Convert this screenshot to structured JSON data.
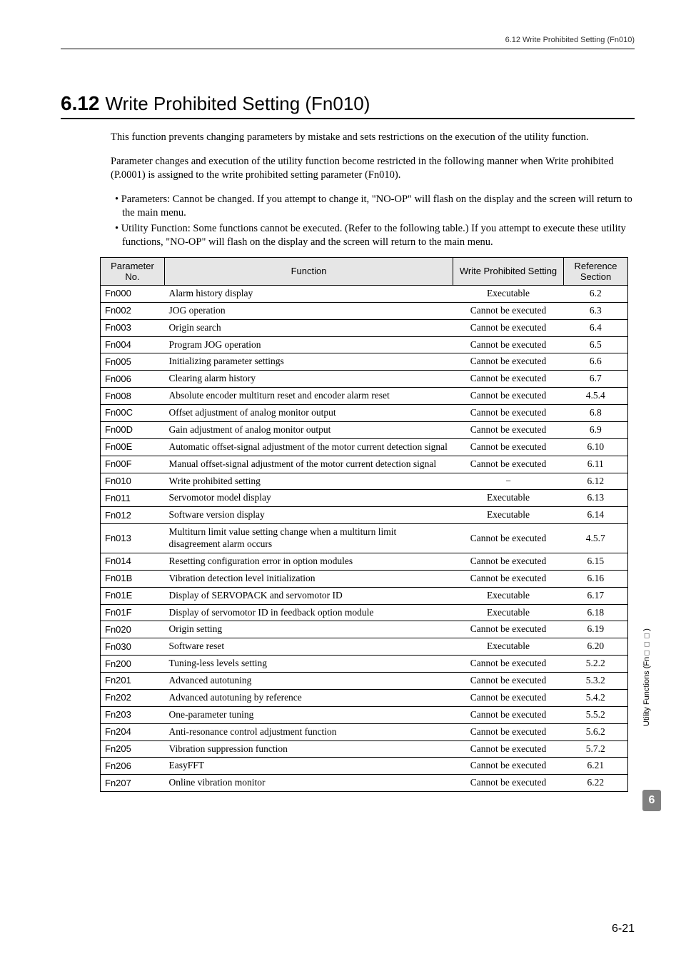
{
  "header": {
    "text": "6.12  Write Prohibited Setting (Fn010)"
  },
  "heading": {
    "num": "6.12",
    "title": "Write Prohibited Setting (Fn010)"
  },
  "intro": {
    "p1": "This function prevents changing parameters by mistake and sets restrictions on the execution of the utility function.",
    "p2": "Parameter changes and execution of the utility function become restricted in the following manner when Write prohibited (P.0001) is assigned to the write prohibited setting parameter (Fn010).",
    "b1": "Parameters: Cannot be changed. If you attempt to change it, \"NO-OP\" will flash on the display and the screen will return to the main menu.",
    "b2": "Utility Function: Some functions cannot be executed. (Refer to the following table.) If you attempt to execute these utility functions, \"NO-OP\" will flash on the display and the screen will return to the main menu."
  },
  "table": {
    "headers": {
      "c1": "Parameter No.",
      "c2": "Function",
      "c3": "Write Prohibited Setting",
      "c4": "Reference Section"
    },
    "rows": [
      {
        "p": "Fn000",
        "f": "Alarm history display",
        "s": "Executable",
        "r": "6.2"
      },
      {
        "p": "Fn002",
        "f": "JOG operation",
        "s": "Cannot be executed",
        "r": "6.3"
      },
      {
        "p": "Fn003",
        "f": "Origin search",
        "s": "Cannot be executed",
        "r": "6.4"
      },
      {
        "p": "Fn004",
        "f": "Program JOG operation",
        "s": "Cannot be executed",
        "r": "6.5"
      },
      {
        "p": "Fn005",
        "f": "Initializing parameter settings",
        "s": "Cannot be executed",
        "r": "6.6"
      },
      {
        "p": "Fn006",
        "f": "Clearing alarm history",
        "s": "Cannot be executed",
        "r": "6.7"
      },
      {
        "p": "Fn008",
        "f": "Absolute encoder multiturn reset and encoder alarm reset",
        "s": "Cannot be executed",
        "r": "4.5.4"
      },
      {
        "p": "Fn00C",
        "f": "Offset adjustment of analog monitor output",
        "s": "Cannot be executed",
        "r": "6.8"
      },
      {
        "p": "Fn00D",
        "f": "Gain adjustment of analog monitor output",
        "s": "Cannot be executed",
        "r": "6.9"
      },
      {
        "p": "Fn00E",
        "f": "Automatic offset-signal adjustment of the motor current detection signal",
        "s": "Cannot be executed",
        "r": "6.10"
      },
      {
        "p": "Fn00F",
        "f": "Manual offset-signal adjustment of the motor current detection signal",
        "s": "Cannot be executed",
        "r": "6.11"
      },
      {
        "p": "Fn010",
        "f": "Write prohibited setting",
        "s": "−",
        "r": "6.12"
      },
      {
        "p": "Fn011",
        "f": "Servomotor model display",
        "s": "Executable",
        "r": "6.13"
      },
      {
        "p": "Fn012",
        "f": "Software version display",
        "s": "Executable",
        "r": "6.14"
      },
      {
        "p": "Fn013",
        "f": "Multiturn limit value setting change when a multiturn limit disagreement alarm occurs",
        "s": "Cannot be executed",
        "r": "4.5.7"
      },
      {
        "p": "Fn014",
        "f": "Resetting configuration error in option modules",
        "s": "Cannot be executed",
        "r": "6.15"
      },
      {
        "p": "Fn01B",
        "f": "Vibration detection level initialization",
        "s": "Cannot be executed",
        "r": "6.16"
      },
      {
        "p": "Fn01E",
        "f": "Display of SERVOPACK and servomotor ID",
        "s": "Executable",
        "r": "6.17"
      },
      {
        "p": "Fn01F",
        "f": "Display of servomotor ID in feedback option module",
        "s": "Executable",
        "r": "6.18"
      },
      {
        "p": "Fn020",
        "f": "Origin setting",
        "s": "Cannot be executed",
        "r": "6.19"
      },
      {
        "p": "Fn030",
        "f": "Software reset",
        "s": "Executable",
        "r": "6.20"
      },
      {
        "p": "Fn200",
        "f": "Tuning-less levels setting",
        "s": "Cannot be executed",
        "r": "5.2.2"
      },
      {
        "p": "Fn201",
        "f": "Advanced autotuning",
        "s": "Cannot be executed",
        "r": "5.3.2"
      },
      {
        "p": "Fn202",
        "f": "Advanced autotuning by reference",
        "s": "Cannot be executed",
        "r": "5.4.2"
      },
      {
        "p": "Fn203",
        "f": "One-parameter tuning",
        "s": "Cannot be executed",
        "r": "5.5.2"
      },
      {
        "p": "Fn204",
        "f": "Anti-resonance control adjustment function",
        "s": "Cannot be executed",
        "r": "5.6.2"
      },
      {
        "p": "Fn205",
        "f": "Vibration suppression function",
        "s": "Cannot be executed",
        "r": "5.7.2"
      },
      {
        "p": "Fn206",
        "f": "EasyFFT",
        "s": "Cannot be executed",
        "r": "6.21"
      },
      {
        "p": "Fn207",
        "f": "Online vibration monitor",
        "s": "Cannot be executed",
        "r": "6.22"
      }
    ]
  },
  "side": {
    "label": "Utility Functions (Fn□□□)",
    "chapter": "6"
  },
  "pagenum": "6-21"
}
